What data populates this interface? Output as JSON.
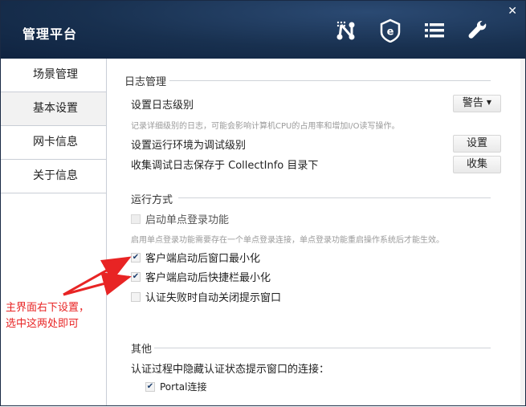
{
  "window": {
    "title": "管理平台",
    "close_glyph": "✕"
  },
  "toolbar": {
    "icons": [
      "network-icon",
      "e-badge-icon",
      "list-icon",
      "wrench-icon"
    ]
  },
  "sidebar": {
    "items": [
      {
        "label": "场景管理",
        "active": false
      },
      {
        "label": "基本设置",
        "active": true
      },
      {
        "label": "网卡信息",
        "active": false
      },
      {
        "label": "关于信息",
        "active": false
      }
    ]
  },
  "log": {
    "heading": "日志管理",
    "level_label": "设置日志级别",
    "level_value": "警告",
    "level_hint": "记录详细级别的日志，可能会影响计算机CPU的占用率和增加I/O读写操作。",
    "debug_label": "设置运行环境为调试级别",
    "debug_button": "设置",
    "collect_label": "收集调试日志保存于 CollectInfo 目录下",
    "collect_button": "收集"
  },
  "run": {
    "heading": "运行方式",
    "sso_label": "启动单点登录功能",
    "sso_checked": false,
    "sso_hint": "启用单点登录功能需要存在一个单点登录连接，单点登录功能重启操作系统后才能生效。",
    "min_window_label": "客户端启动后窗口最小化",
    "min_window_checked": true,
    "min_taskbar_label": "客户端启动后快捷栏最小化",
    "min_taskbar_checked": true,
    "auto_close_label": "认证失败时自动关闭提示窗口",
    "auto_close_checked": false
  },
  "other": {
    "heading": "其他",
    "hide_label": "认证过程中隐藏认证状态提示窗口的连接：",
    "portal_label": "Portal连接",
    "portal_checked": true
  },
  "annotation": {
    "line1": "主界面右下设置，",
    "line2": "选中这两处即可",
    "color": "#e82424"
  },
  "colors": {
    "titlebar": "#18304f",
    "check": "#1d3f6e"
  }
}
